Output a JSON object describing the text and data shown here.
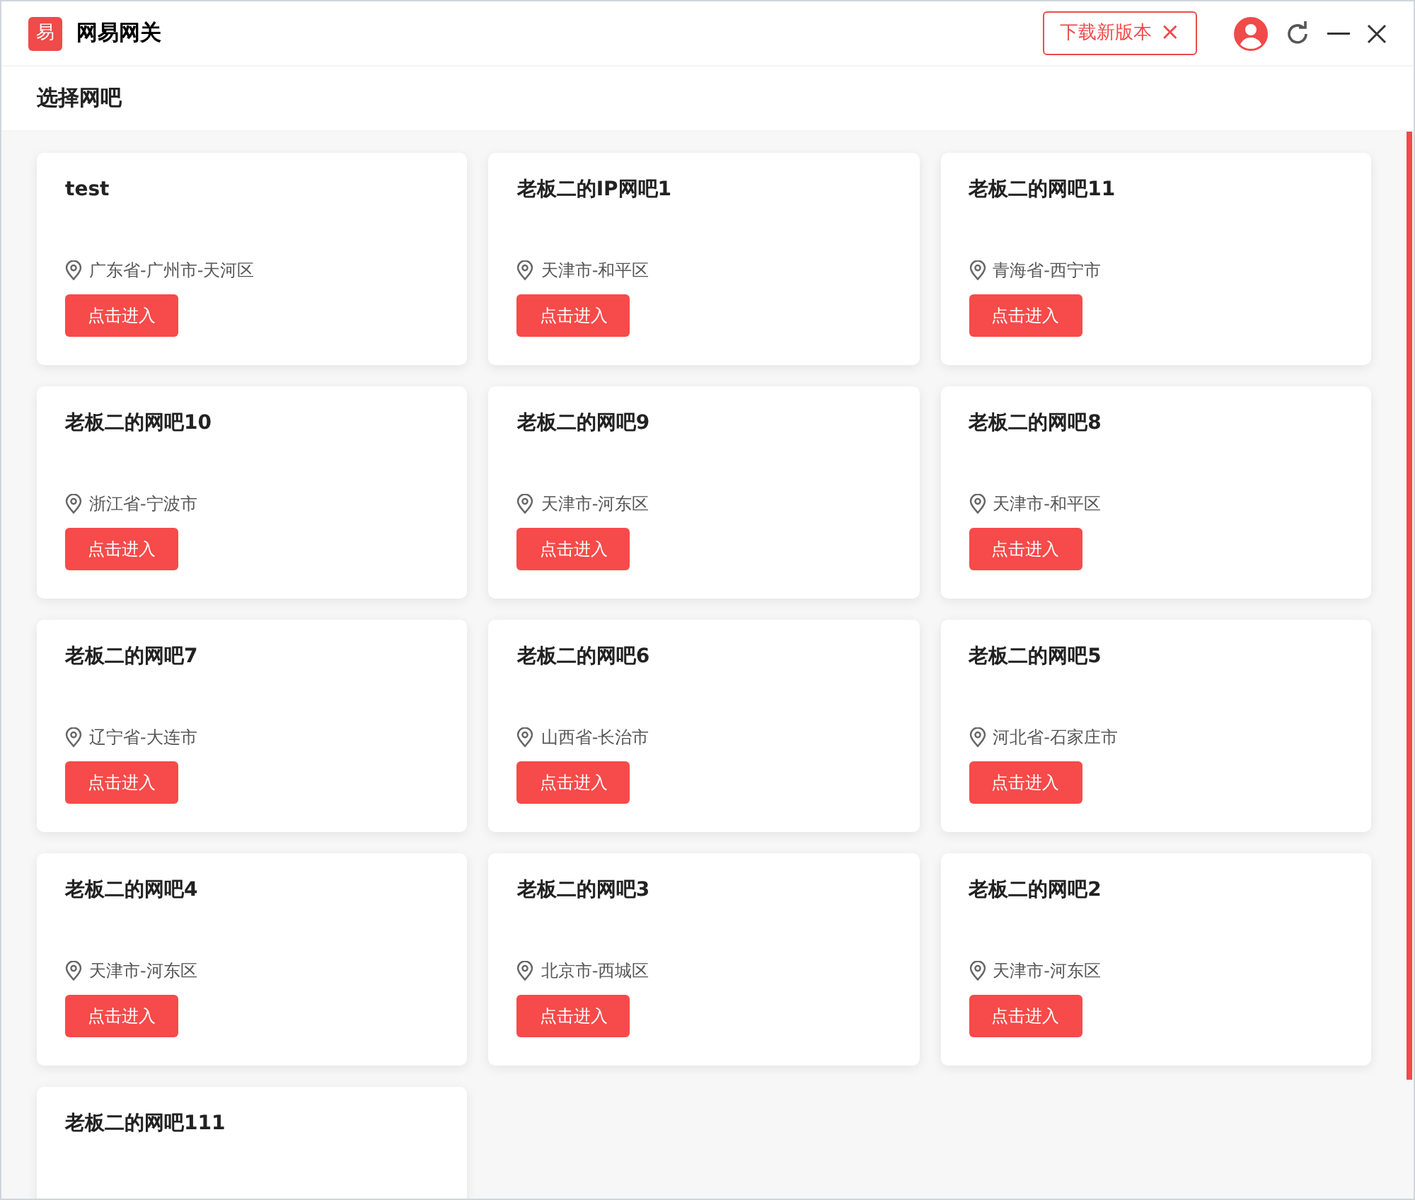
{
  "app": {
    "logo": "易",
    "title": "网易网关"
  },
  "update_button": {
    "label": "下载新版本",
    "close": "×"
  },
  "page_title": "选择网吧",
  "cafes": [
    {
      "name": "test",
      "location": "广东省-广州市-天河区",
      "button": "点击进入"
    },
    {
      "name": "老板二的IP网吧1",
      "location": "天津市-和平区",
      "button": "点击进入"
    },
    {
      "name": "老板二的网吧11",
      "location": "青海省-西宁市",
      "button": "点击进入"
    },
    {
      "name": "老板二的网吧10",
      "location": "浙江省-宁波市",
      "button": "点击进入"
    },
    {
      "name": "老板二的网吧9",
      "location": "天津市-河东区",
      "button": "点击进入"
    },
    {
      "name": "老板二的网吧8",
      "location": "天津市-和平区",
      "button": "点击进入"
    },
    {
      "name": "老板二的网吧7",
      "location": "辽宁省-大连市",
      "button": "点击进入"
    },
    {
      "name": "老板二的网吧6",
      "location": "山西省-长治市",
      "button": "点击进入"
    },
    {
      "name": "老板二的网吧5",
      "location": "河北省-石家庄市",
      "button": "点击进入"
    },
    {
      "name": "老板二的网吧4",
      "location": "天津市-河东区",
      "button": "点击进入"
    },
    {
      "name": "老板二的网吧3",
      "location": "北京市-西城区",
      "button": "点击进入"
    },
    {
      "name": "老板二的网吧2",
      "location": "天津市-河东区",
      "button": "点击进入"
    },
    {
      "name": "老板二的网吧111"
    }
  ]
}
